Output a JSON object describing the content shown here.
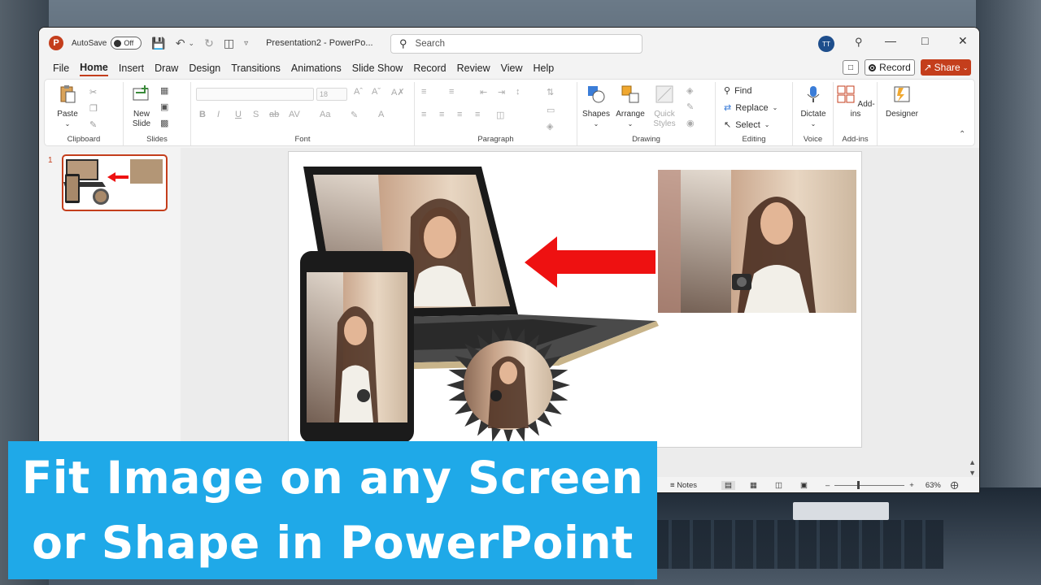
{
  "titlebar": {
    "autosave_label": "AutoSave",
    "autosave_state": "Off",
    "doc_title": "Presentation2  -  PowerPo...",
    "search_placeholder": "Search",
    "user_initials": "TT"
  },
  "menu": {
    "items": [
      "File",
      "Home",
      "Insert",
      "Draw",
      "Design",
      "Transitions",
      "Animations",
      "Slide Show",
      "Record",
      "Review",
      "View",
      "Help"
    ],
    "active": "Home",
    "record_label": "Record",
    "share_label": "Share"
  },
  "ribbon": {
    "clipboard": {
      "label": "Clipboard",
      "paste": "Paste"
    },
    "slides": {
      "label": "Slides",
      "new_slide": "New",
      "new_slide2": "Slide"
    },
    "font": {
      "label": "Font",
      "size": "18"
    },
    "paragraph": {
      "label": "Paragraph"
    },
    "drawing": {
      "label": "Drawing",
      "shapes": "Shapes",
      "arrange": "Arrange",
      "quick_styles_1": "Quick",
      "quick_styles_2": "Styles"
    },
    "editing": {
      "label": "Editing",
      "find": "Find",
      "replace": "Replace",
      "select": "Select"
    },
    "voice": {
      "label": "Voice",
      "dictate": "Dictate"
    },
    "addins": {
      "label": "Add-ins",
      "addins_btn": "Add-ins"
    },
    "designer": {
      "label": "Designer"
    }
  },
  "thumbnails": {
    "slide_number": "1"
  },
  "statusbar": {
    "notes": "Notes",
    "zoom": "63%"
  },
  "banner": {
    "line1": "Fit Image on any Screen",
    "line2": "or Shape in PowerPoint"
  },
  "colors": {
    "accent": "#c43e1c",
    "banner": "#1fa9e8",
    "arrow": "#ee1111"
  }
}
